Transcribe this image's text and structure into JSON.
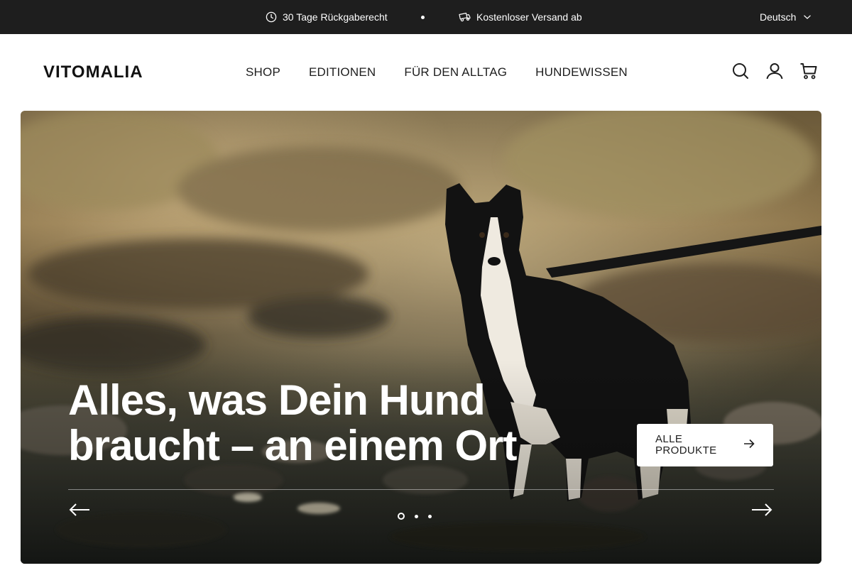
{
  "announcement": {
    "item1": {
      "text": "30 Tage Rückgaberecht",
      "icon": "clock-icon"
    },
    "item2": {
      "text": "Kostenloser Versand ab",
      "icon": "truck-icon"
    },
    "language": "Deutsch"
  },
  "header": {
    "logo": "VITOMALIA",
    "nav": [
      "SHOP",
      "EDITIONEN",
      "FÜR DEN ALLTAG",
      "HUNDEWISSEN"
    ],
    "icons": [
      "search-icon",
      "account-icon",
      "cart-icon"
    ]
  },
  "hero": {
    "title": "Alles, was Dein Hund braucht – an einem Ort",
    "cta_label": "ALLE PRODUKTE",
    "slides_total": 3,
    "active_slide": 1
  },
  "colors": {
    "topbar_bg": "#1e1e1e",
    "text_dark": "#1e1e1e",
    "white": "#ffffff"
  }
}
